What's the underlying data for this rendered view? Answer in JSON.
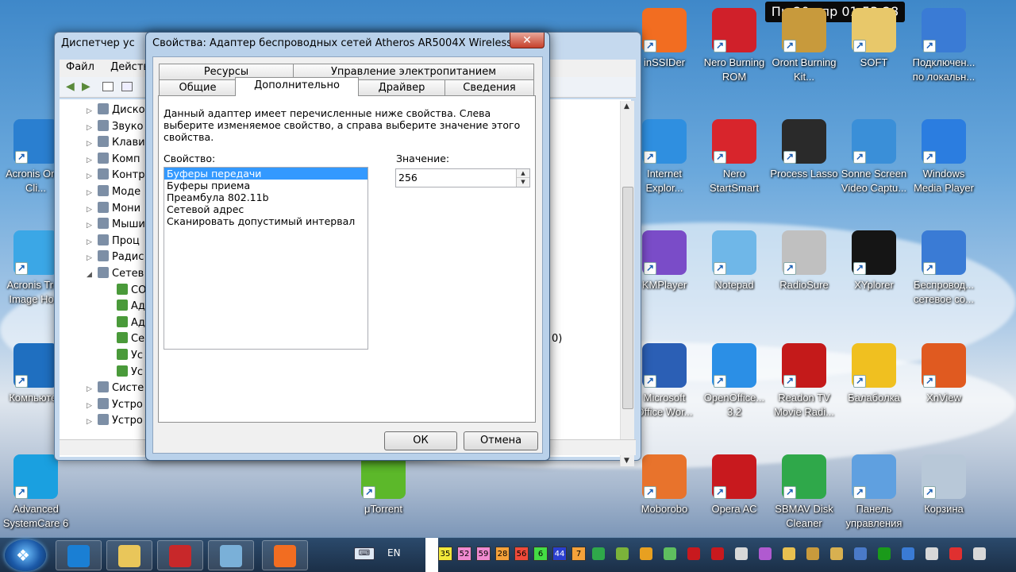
{
  "clock": "Пн.20.апр 01:53:28",
  "desktop_icons": [
    {
      "label": "Acronis One-Cli...",
      "color": "#2a7fd0"
    },
    {
      "label": "Acronis True Image Ho...",
      "color": "#3ba7e6"
    },
    {
      "label": "Компьютер",
      "color": "#1f6fc0"
    },
    {
      "label": "Advanced SystemCare 6",
      "color": "#1aa0e0"
    },
    {
      "label": "μTorrent",
      "color": "#5cb82a"
    },
    {
      "label": "inSSIDer",
      "color": "#f26d21"
    },
    {
      "label": "Nero Burning ROM",
      "color": "#d0202a"
    },
    {
      "label": "Oront Burning Kit...",
      "color": "#c89a3c"
    },
    {
      "label": "SOFT",
      "color": "#e8c86a"
    },
    {
      "label": "Подключен... по локальн...",
      "color": "#3a7bd5"
    },
    {
      "label": "Internet Explor...",
      "color": "#2f8fe0"
    },
    {
      "label": "Nero StartSmart",
      "color": "#d8252c"
    },
    {
      "label": "Process Lasso",
      "color": "#2a2a2a"
    },
    {
      "label": "Sonne Screen Video Captu...",
      "color": "#3a8fd8"
    },
    {
      "label": "Windows Media Player",
      "color": "#2b7de0"
    },
    {
      "label": "KMPlayer",
      "color": "#7a4cc8"
    },
    {
      "label": "Notepad",
      "color": "#6fb7e8"
    },
    {
      "label": "RadioSure",
      "color": "#c0c0c0"
    },
    {
      "label": "XYplorer",
      "color": "#151515"
    },
    {
      "label": "Беспровод... сетевое со...",
      "color": "#3a7bd5"
    },
    {
      "label": "Microsoft Office Wor...",
      "color": "#2b5fb5"
    },
    {
      "label": "OpenOffice... 3.2",
      "color": "#2b8fe6"
    },
    {
      "label": "Readon TV Movie Radi...",
      "color": "#c41a1a"
    },
    {
      "label": "Балаболка",
      "color": "#f0c020"
    },
    {
      "label": "XnView",
      "color": "#e05a20"
    },
    {
      "label": "Moborobo",
      "color": "#e8732c"
    },
    {
      "label": "Opera AC",
      "color": "#c8191e"
    },
    {
      "label": "SBMAV Disk Cleaner",
      "color": "#2fa84a"
    },
    {
      "label": "Панель управления",
      "color": "#5fa0e0"
    },
    {
      "label": "Корзина",
      "color": "#b8c8d8"
    }
  ],
  "devmgr": {
    "title": "Диспетчер ус",
    "menu": [
      "Файл",
      "Действи"
    ],
    "tree": [
      {
        "label": "Диско",
        "expander": "▷"
      },
      {
        "label": "Звуко",
        "expander": "▷"
      },
      {
        "label": "Клави",
        "expander": "▷"
      },
      {
        "label": "Комп",
        "expander": "▷"
      },
      {
        "label": "Контр",
        "expander": "▷"
      },
      {
        "label": "Моде",
        "expander": "▷"
      },
      {
        "label": "Мони",
        "expander": "▷"
      },
      {
        "label": "Мыши",
        "expander": "▷"
      },
      {
        "label": "Проц",
        "expander": "▷"
      },
      {
        "label": "Радис",
        "expander": "▷"
      },
      {
        "label": "Сетев",
        "expander": "◢"
      },
      {
        "label": "CO",
        "expander": ""
      },
      {
        "label": "Ад",
        "expander": ""
      },
      {
        "label": "Ад",
        "expander": ""
      },
      {
        "label": "Се",
        "expander": ""
      },
      {
        "label": "Ус",
        "expander": ""
      },
      {
        "label": "Ус",
        "expander": ""
      },
      {
        "label": "Систе",
        "expander": "▷"
      },
      {
        "label": "Устро",
        "expander": "▷"
      },
      {
        "label": "Устро",
        "expander": "▷"
      }
    ],
    "fragment": "0)"
  },
  "dialog": {
    "title": "Свойства: Адаптер беспроводных сетей Atheros AR5004X Wireless",
    "close": "✕",
    "tabs_row1": [
      "Ресурсы",
      "Управление электропитанием"
    ],
    "tabs_row2": [
      "Общие",
      "Дополнительно",
      "Драйвер",
      "Сведения"
    ],
    "description": "Данный адаптер имеет перечисленные ниже свойства. Слева выберите изменяемое свойство, а справа выберите значение этого свойства.",
    "property_label": "Свойство:",
    "value_label": "Значение:",
    "properties": [
      "Буферы передачи",
      "Буферы приема",
      "Преамбула 802.11b",
      "Сетевой адрес",
      "Сканировать допустимый интервал"
    ],
    "selected_index": 0,
    "value": "256",
    "ok": "ОК",
    "cancel": "Отмена"
  },
  "taskbar": {
    "lang": "EN",
    "keyboard": "⌨",
    "badges": [
      {
        "text": "35",
        "color": "#f3e83a"
      },
      {
        "text": "52",
        "color": "#f08ad0"
      },
      {
        "text": "59",
        "color": "#f08ad0"
      },
      {
        "text": "28",
        "color": "#f5a23a"
      },
      {
        "text": "56",
        "color": "#f04a3a"
      },
      {
        "text": "6",
        "color": "#44dd44"
      },
      {
        "text": "44",
        "color": "#2a3fd0"
      },
      {
        "text": "7",
        "color": "#f5a23a"
      }
    ]
  }
}
